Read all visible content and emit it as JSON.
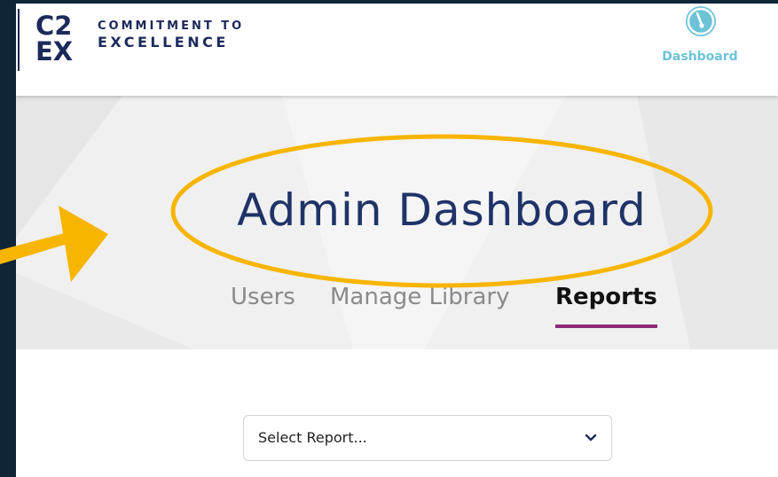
{
  "brand": {
    "mark_top": "C2",
    "mark_bottom": "EX",
    "line1": "COMMITMENT TO",
    "line2": "EXCELLENCE"
  },
  "header": {
    "dashboard_label": "Dashboard",
    "dashboard_icon": "gauge-icon"
  },
  "hero": {
    "title": "Admin Dashboard"
  },
  "tabs": [
    {
      "label": "Users",
      "active": false
    },
    {
      "label": "Manage Library",
      "active": false
    },
    {
      "label": "Reports",
      "active": true
    }
  ],
  "report_select": {
    "value": "Select Report..."
  },
  "colors": {
    "brand_navy": "#1b2a5a",
    "title_blue": "#1f3368",
    "accent_teal": "#6cc3d8",
    "tab_active_underline": "#8e2a7a",
    "annotation_yellow": "#f7b500",
    "frame_background": "#0f2538"
  }
}
